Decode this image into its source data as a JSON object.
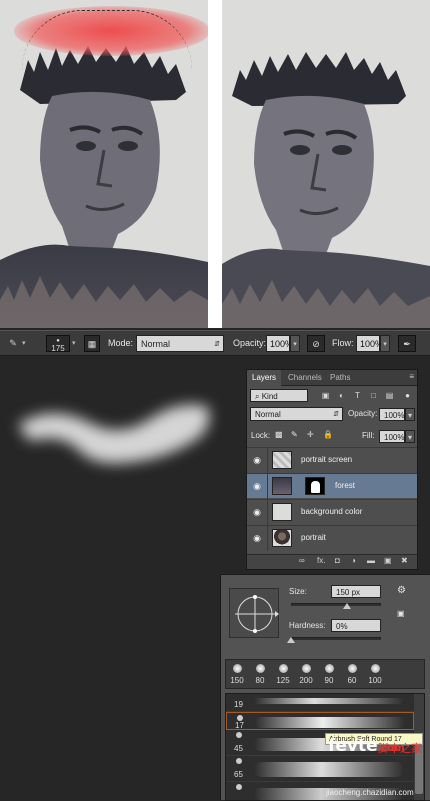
{
  "options_bar": {
    "brush_size": "175",
    "mode_label": "Mode:",
    "mode_value": "Normal",
    "opacity_label": "Opacity:",
    "opacity_value": "100%",
    "flow_label": "Flow:",
    "flow_value": "100%",
    "icons": [
      "brush-tool-icon",
      "brush-preset-icon",
      "toggle-brush-panel-icon",
      "pressure-opacity-icon",
      "airbrush-icon"
    ]
  },
  "layers_panel": {
    "tabs": [
      "Layers",
      "Channels",
      "Paths"
    ],
    "filter_kind": "⌕ Kind",
    "blend_mode": "Normal",
    "opacity_label": "Opacity:",
    "opacity_value": "100%",
    "lock_label": "Lock:",
    "fill_label": "Fill:",
    "fill_value": "100%",
    "layers": [
      {
        "name": "portrait screen",
        "visible": true,
        "selected": false
      },
      {
        "name": "forest",
        "visible": true,
        "selected": true
      },
      {
        "name": "background color",
        "visible": true,
        "selected": false
      },
      {
        "name": "portrait",
        "visible": true,
        "selected": false
      }
    ],
    "footer_icons": [
      "link-icon",
      "fx-icon",
      "mask-icon",
      "adjustment-icon",
      "folder-icon",
      "new-layer-icon",
      "trash-icon"
    ],
    "footer_fx": "fx."
  },
  "brush_panel": {
    "size_label": "Size:",
    "size_value": "150 px",
    "hardness_label": "Hardness:",
    "hardness_value": "0%",
    "preset_sizes": [
      "150",
      "80",
      "125",
      "200",
      "90",
      "60",
      "100"
    ],
    "list_sizes": [
      "19",
      "17",
      "45",
      "65"
    ],
    "tooltip": "Airbrush Soft Round 17"
  },
  "watermark": {
    "logo_a": "fevte",
    "logo_b": ".com",
    "chinese": "脚本之家",
    "url": "jiaocheng.chazidian.com"
  },
  "colors": {
    "selection_red": "#ee4646",
    "layer_selected": "#677a93",
    "panel_bg": "#4e4e4e",
    "canvas_bg": "#262626"
  }
}
